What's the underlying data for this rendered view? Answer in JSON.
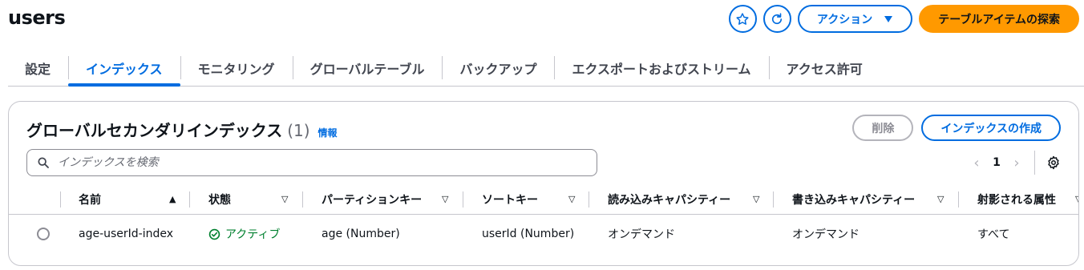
{
  "header": {
    "title": "users",
    "actions_label": "アクション",
    "explore_label": "テーブルアイテムの探索"
  },
  "tabs": [
    {
      "label": "設定",
      "active": false
    },
    {
      "label": "インデックス",
      "active": true
    },
    {
      "label": "モニタリング",
      "active": false
    },
    {
      "label": "グローバルテーブル",
      "active": false
    },
    {
      "label": "バックアップ",
      "active": false
    },
    {
      "label": "エクスポートおよびストリーム",
      "active": false
    },
    {
      "label": "アクセス許可",
      "active": false
    }
  ],
  "gsi": {
    "title": "グローバルセカンダリインデックス",
    "count": "(1)",
    "info_link": "情報",
    "delete_label": "削除",
    "create_label": "インデックスの作成",
    "search_placeholder": "インデックスを検索",
    "page": "1",
    "columns": [
      "名前",
      "状態",
      "パーティションキー",
      "ソートキー",
      "読み込みキャパシティー",
      "書き込みキャパシティー",
      "射影される属性"
    ],
    "rows": [
      {
        "name": "age-userId-index",
        "status": "アクティブ",
        "partition_key": "age (Number)",
        "sort_key": "userId (Number)",
        "read_capacity": "オンデマンド",
        "write_capacity": "オンデマンド",
        "projected": "すべて"
      }
    ]
  },
  "colors": {
    "accent": "#006ce0",
    "primary_button": "#ff9900",
    "success": "#00802f"
  }
}
